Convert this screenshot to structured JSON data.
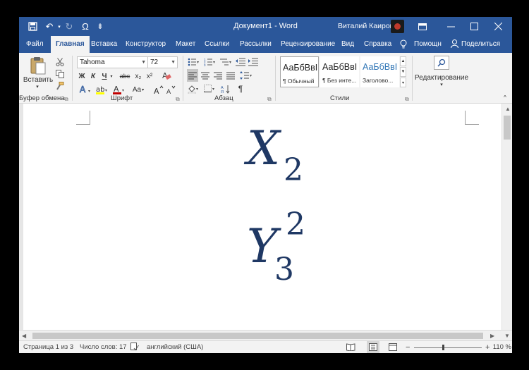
{
  "window": {
    "title": "Документ1 - Word",
    "user_name": "Виталий Каиров",
    "colors": {
      "title_bar": "#2b579a",
      "ribbon": "#f3f3f3",
      "equation_text": "#1f3864"
    },
    "quick_access": [
      "save-icon",
      "undo-icon",
      "redo-icon",
      "omega-symbol-icon",
      "customize-icon"
    ],
    "quick_access_glyphs": {
      "undo": "↶",
      "redo": "↻",
      "omega": "Ω",
      "customize": "⇟"
    },
    "controls": [
      "ribbon-display-options-icon",
      "minimize-icon",
      "maximize-icon",
      "close-icon"
    ]
  },
  "tabs": [
    {
      "label": "Файл"
    },
    {
      "label": "Главная",
      "active": true
    },
    {
      "label": "Вставка"
    },
    {
      "label": "Конструктор"
    },
    {
      "label": "Макет"
    },
    {
      "label": "Ссылки"
    },
    {
      "label": "Рассылки"
    },
    {
      "label": "Рецензирование"
    },
    {
      "label": "Вид"
    },
    {
      "label": "Справка"
    },
    {
      "label": "Помощн"
    },
    {
      "label": "Поделиться"
    }
  ],
  "ribbon": {
    "clipboard": {
      "label": "Буфер обмена",
      "paste_label": "Вставить"
    },
    "font": {
      "label": "Шрифт",
      "font_name": "Tahoma",
      "font_size": "72",
      "bold": "Ж",
      "italic": "К",
      "underline": "Ч",
      "strikethrough": "abc",
      "subscript": "x₂",
      "superscript": "x²",
      "grow": "A^",
      "shrink": "Aˇ",
      "case": "Aa",
      "highlight_color": "#ffff00",
      "font_color": "#c00000"
    },
    "paragraph": {
      "label": "Абзац",
      "pilcrow": "¶"
    },
    "styles": {
      "label": "Стили",
      "items": [
        {
          "sample": "АаБбВвI",
          "name": "¶ Обычный",
          "selected": true
        },
        {
          "sample": "АаБбВвI",
          "name": "¶ Без инте..."
        },
        {
          "sample": "АаБбВвI",
          "name": "Заголово..."
        }
      ]
    },
    "editing": {
      "label": "Редактирование"
    }
  },
  "document": {
    "equations": [
      {
        "base": "X",
        "subscript": "2"
      },
      {
        "base": "Y",
        "subscript": "3",
        "superscript": "2"
      }
    ]
  },
  "statusbar": {
    "page": "Страница 1 из 3",
    "words": "Число слов: 17",
    "language": "английский (США)",
    "zoom": "110 %",
    "zoom_minus": "−",
    "zoom_plus": "+"
  }
}
